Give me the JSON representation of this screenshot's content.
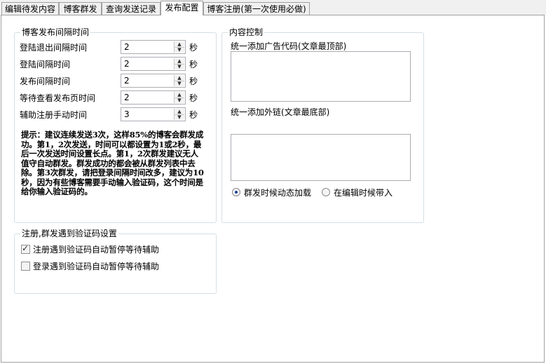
{
  "tabs": [
    {
      "label": "编辑待发内容"
    },
    {
      "label": "博客群发"
    },
    {
      "label": "查询发送记录"
    },
    {
      "label": "发布配置"
    },
    {
      "label": "博客注册(第一次使用必做)"
    }
  ],
  "interval_group": {
    "title": "博客发布间隔时间",
    "rows": [
      {
        "label": "登陆退出间隔时间",
        "value": "2",
        "unit": "秒"
      },
      {
        "label": "登陆间隔时间",
        "value": "2",
        "unit": "秒"
      },
      {
        "label": "发布间隔时间",
        "value": "2",
        "unit": "秒"
      },
      {
        "label": "等待查看发布页时间",
        "value": "2",
        "unit": "秒"
      },
      {
        "label": "辅助注册手动时间",
        "value": "3",
        "unit": "秒"
      }
    ],
    "hint": "提示：建议连续发送3次，这样85%的博客会群发成功。第1，2次发送，时间可以都设置为1或2秒，最后一次发送时间设置长点。第1，2次群发建议无人值守自动群发。群发成功的都会被从群发列表中去除。第3次群发，请把登录间隔时间改多，建议为10秒，因为有些博客需要手动输入验证码，这个时间是给你输入验证码的。"
  },
  "content_group": {
    "title": "内容控制",
    "ad_label": "统一添加广告代码(文章最顶部)",
    "ad_value": "",
    "link_label": "统一添加外链(文章最底部)",
    "link_value": "",
    "radio_options": [
      {
        "label": "群发时候动态加载",
        "selected": true
      },
      {
        "label": "在编辑时候带入",
        "selected": false
      }
    ]
  },
  "captcha_group": {
    "title": "注册,群发遇到验证码设置",
    "options": [
      {
        "label": "注册遇到验证码自动暂停等待辅助",
        "checked": true
      },
      {
        "label": "登录遇到验证码自动暂停等待辅助",
        "checked": false
      }
    ]
  }
}
